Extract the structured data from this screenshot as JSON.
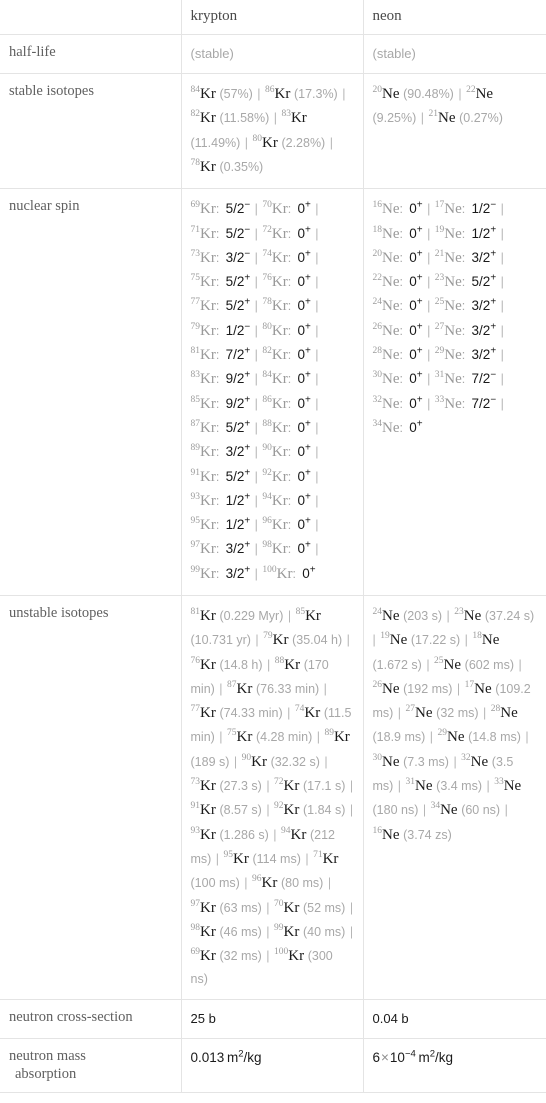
{
  "table": {
    "columns": [
      "",
      "krypton",
      "neon"
    ],
    "rows": [
      {
        "label": "half-life",
        "krypton": {
          "kind": "plain_muted",
          "text": "(stable)"
        },
        "neon": {
          "kind": "plain_muted",
          "text": "(stable)"
        }
      },
      {
        "label": "stable isotopes",
        "krypton": {
          "kind": "isotope_list",
          "items": [
            {
              "mass": "84",
              "symbol": "Kr",
              "value": "(57%)"
            },
            {
              "mass": "86",
              "symbol": "Kr",
              "value": "(17.3%)"
            },
            {
              "mass": "82",
              "symbol": "Kr",
              "value": "(11.58%)"
            },
            {
              "mass": "83",
              "symbol": "Kr",
              "value": "(11.49%)"
            },
            {
              "mass": "80",
              "symbol": "Kr",
              "value": "(2.28%)"
            },
            {
              "mass": "78",
              "symbol": "Kr",
              "value": "(0.35%)"
            }
          ]
        },
        "neon": {
          "kind": "isotope_list",
          "items": [
            {
              "mass": "20",
              "symbol": "Ne",
              "value": "(90.48%)"
            },
            {
              "mass": "22",
              "symbol": "Ne",
              "value": "(9.25%)"
            },
            {
              "mass": "21",
              "symbol": "Ne",
              "value": "(0.27%)"
            }
          ]
        }
      },
      {
        "label": "nuclear spin",
        "krypton": {
          "kind": "spin_list",
          "items": [
            {
              "mass": "69",
              "symbol": "Kr",
              "spin": "5/2",
              "sign": "−"
            },
            {
              "mass": "70",
              "symbol": "Kr",
              "spin": "0",
              "sign": "+"
            },
            {
              "mass": "71",
              "symbol": "Kr",
              "spin": "5/2",
              "sign": "−"
            },
            {
              "mass": "72",
              "symbol": "Kr",
              "spin": "0",
              "sign": "+"
            },
            {
              "mass": "73",
              "symbol": "Kr",
              "spin": "3/2",
              "sign": "−"
            },
            {
              "mass": "74",
              "symbol": "Kr",
              "spin": "0",
              "sign": "+"
            },
            {
              "mass": "75",
              "symbol": "Kr",
              "spin": "5/2",
              "sign": "+"
            },
            {
              "mass": "76",
              "symbol": "Kr",
              "spin": "0",
              "sign": "+"
            },
            {
              "mass": "77",
              "symbol": "Kr",
              "spin": "5/2",
              "sign": "+"
            },
            {
              "mass": "78",
              "symbol": "Kr",
              "spin": "0",
              "sign": "+"
            },
            {
              "mass": "79",
              "symbol": "Kr",
              "spin": "1/2",
              "sign": "−"
            },
            {
              "mass": "80",
              "symbol": "Kr",
              "spin": "0",
              "sign": "+"
            },
            {
              "mass": "81",
              "symbol": "Kr",
              "spin": "7/2",
              "sign": "+"
            },
            {
              "mass": "82",
              "symbol": "Kr",
              "spin": "0",
              "sign": "+"
            },
            {
              "mass": "83",
              "symbol": "Kr",
              "spin": "9/2",
              "sign": "+"
            },
            {
              "mass": "84",
              "symbol": "Kr",
              "spin": "0",
              "sign": "+"
            },
            {
              "mass": "85",
              "symbol": "Kr",
              "spin": "9/2",
              "sign": "+"
            },
            {
              "mass": "86",
              "symbol": "Kr",
              "spin": "0",
              "sign": "+"
            },
            {
              "mass": "87",
              "symbol": "Kr",
              "spin": "5/2",
              "sign": "+"
            },
            {
              "mass": "88",
              "symbol": "Kr",
              "spin": "0",
              "sign": "+"
            },
            {
              "mass": "89",
              "symbol": "Kr",
              "spin": "3/2",
              "sign": "+"
            },
            {
              "mass": "90",
              "symbol": "Kr",
              "spin": "0",
              "sign": "+"
            },
            {
              "mass": "91",
              "symbol": "Kr",
              "spin": "5/2",
              "sign": "+"
            },
            {
              "mass": "92",
              "symbol": "Kr",
              "spin": "0",
              "sign": "+"
            },
            {
              "mass": "93",
              "symbol": "Kr",
              "spin": "1/2",
              "sign": "+"
            },
            {
              "mass": "94",
              "symbol": "Kr",
              "spin": "0",
              "sign": "+"
            },
            {
              "mass": "95",
              "symbol": "Kr",
              "spin": "1/2",
              "sign": "+"
            },
            {
              "mass": "96",
              "symbol": "Kr",
              "spin": "0",
              "sign": "+"
            },
            {
              "mass": "97",
              "symbol": "Kr",
              "spin": "3/2",
              "sign": "+"
            },
            {
              "mass": "98",
              "symbol": "Kr",
              "spin": "0",
              "sign": "+"
            },
            {
              "mass": "99",
              "symbol": "Kr",
              "spin": "3/2",
              "sign": "+"
            },
            {
              "mass": "100",
              "symbol": "Kr",
              "spin": "0",
              "sign": "+"
            }
          ]
        },
        "neon": {
          "kind": "spin_list",
          "items": [
            {
              "mass": "16",
              "symbol": "Ne",
              "spin": "0",
              "sign": "+"
            },
            {
              "mass": "17",
              "symbol": "Ne",
              "spin": "1/2",
              "sign": "−"
            },
            {
              "mass": "18",
              "symbol": "Ne",
              "spin": "0",
              "sign": "+"
            },
            {
              "mass": "19",
              "symbol": "Ne",
              "spin": "1/2",
              "sign": "+"
            },
            {
              "mass": "20",
              "symbol": "Ne",
              "spin": "0",
              "sign": "+"
            },
            {
              "mass": "21",
              "symbol": "Ne",
              "spin": "3/2",
              "sign": "+"
            },
            {
              "mass": "22",
              "symbol": "Ne",
              "spin": "0",
              "sign": "+"
            },
            {
              "mass": "23",
              "symbol": "Ne",
              "spin": "5/2",
              "sign": "+"
            },
            {
              "mass": "24",
              "symbol": "Ne",
              "spin": "0",
              "sign": "+"
            },
            {
              "mass": "25",
              "symbol": "Ne",
              "spin": "3/2",
              "sign": "+"
            },
            {
              "mass": "26",
              "symbol": "Ne",
              "spin": "0",
              "sign": "+"
            },
            {
              "mass": "27",
              "symbol": "Ne",
              "spin": "3/2",
              "sign": "+"
            },
            {
              "mass": "28",
              "symbol": "Ne",
              "spin": "0",
              "sign": "+"
            },
            {
              "mass": "29",
              "symbol": "Ne",
              "spin": "3/2",
              "sign": "+"
            },
            {
              "mass": "30",
              "symbol": "Ne",
              "spin": "0",
              "sign": "+"
            },
            {
              "mass": "31",
              "symbol": "Ne",
              "spin": "7/2",
              "sign": "−"
            },
            {
              "mass": "32",
              "symbol": "Ne",
              "spin": "0",
              "sign": "+"
            },
            {
              "mass": "33",
              "symbol": "Ne",
              "spin": "7/2",
              "sign": "−"
            },
            {
              "mass": "34",
              "symbol": "Ne",
              "spin": "0",
              "sign": "+"
            }
          ]
        }
      },
      {
        "label": "unstable isotopes",
        "krypton": {
          "kind": "isotope_list",
          "items": [
            {
              "mass": "81",
              "symbol": "Kr",
              "value": "(0.229 Myr)"
            },
            {
              "mass": "85",
              "symbol": "Kr",
              "value": "(10.731 yr)"
            },
            {
              "mass": "79",
              "symbol": "Kr",
              "value": "(35.04 h)"
            },
            {
              "mass": "76",
              "symbol": "Kr",
              "value": "(14.8 h)"
            },
            {
              "mass": "88",
              "symbol": "Kr",
              "value": "(170 min)"
            },
            {
              "mass": "87",
              "symbol": "Kr",
              "value": "(76.33 min)"
            },
            {
              "mass": "77",
              "symbol": "Kr",
              "value": "(74.33 min)"
            },
            {
              "mass": "74",
              "symbol": "Kr",
              "value": "(11.5 min)"
            },
            {
              "mass": "75",
              "symbol": "Kr",
              "value": "(4.28 min)"
            },
            {
              "mass": "89",
              "symbol": "Kr",
              "value": "(189 s)"
            },
            {
              "mass": "90",
              "symbol": "Kr",
              "value": "(32.32 s)"
            },
            {
              "mass": "73",
              "symbol": "Kr",
              "value": "(27.3 s)"
            },
            {
              "mass": "72",
              "symbol": "Kr",
              "value": "(17.1 s)"
            },
            {
              "mass": "91",
              "symbol": "Kr",
              "value": "(8.57 s)"
            },
            {
              "mass": "92",
              "symbol": "Kr",
              "value": "(1.84 s)"
            },
            {
              "mass": "93",
              "symbol": "Kr",
              "value": "(1.286 s)"
            },
            {
              "mass": "94",
              "symbol": "Kr",
              "value": "(212 ms)"
            },
            {
              "mass": "95",
              "symbol": "Kr",
              "value": "(114 ms)"
            },
            {
              "mass": "71",
              "symbol": "Kr",
              "value": "(100 ms)"
            },
            {
              "mass": "96",
              "symbol": "Kr",
              "value": "(80 ms)"
            },
            {
              "mass": "97",
              "symbol": "Kr",
              "value": "(63 ms)"
            },
            {
              "mass": "70",
              "symbol": "Kr",
              "value": "(52 ms)"
            },
            {
              "mass": "98",
              "symbol": "Kr",
              "value": "(46 ms)"
            },
            {
              "mass": "99",
              "symbol": "Kr",
              "value": "(40 ms)"
            },
            {
              "mass": "69",
              "symbol": "Kr",
              "value": "(32 ms)"
            },
            {
              "mass": "100",
              "symbol": "Kr",
              "value": "(300 ns)"
            }
          ]
        },
        "neon": {
          "kind": "isotope_list",
          "items": [
            {
              "mass": "24",
              "symbol": "Ne",
              "value": "(203 s)"
            },
            {
              "mass": "23",
              "symbol": "Ne",
              "value": "(37.24 s)"
            },
            {
              "mass": "19",
              "symbol": "Ne",
              "value": "(17.22 s)"
            },
            {
              "mass": "18",
              "symbol": "Ne",
              "value": "(1.672 s)"
            },
            {
              "mass": "25",
              "symbol": "Ne",
              "value": "(602 ms)"
            },
            {
              "mass": "26",
              "symbol": "Ne",
              "value": "(192 ms)"
            },
            {
              "mass": "17",
              "symbol": "Ne",
              "value": "(109.2 ms)"
            },
            {
              "mass": "27",
              "symbol": "Ne",
              "value": "(32 ms)"
            },
            {
              "mass": "28",
              "symbol": "Ne",
              "value": "(18.9 ms)"
            },
            {
              "mass": "29",
              "symbol": "Ne",
              "value": "(14.8 ms)"
            },
            {
              "mass": "30",
              "symbol": "Ne",
              "value": "(7.3 ms)"
            },
            {
              "mass": "32",
              "symbol": "Ne",
              "value": "(3.5 ms)"
            },
            {
              "mass": "31",
              "symbol": "Ne",
              "value": "(3.4 ms)"
            },
            {
              "mass": "33",
              "symbol": "Ne",
              "value": "(180 ns)"
            },
            {
              "mass": "34",
              "symbol": "Ne",
              "value": "(60 ns)"
            },
            {
              "mass": "16",
              "symbol": "Ne",
              "value": "(3.74 zs)"
            }
          ]
        }
      },
      {
        "label": "neutron cross-section",
        "krypton": {
          "kind": "plain",
          "text": "25 b"
        },
        "neon": {
          "kind": "plain",
          "text": "0.04 b"
        }
      },
      {
        "label": "neutron mass absorption",
        "label_line1": "neutron mass",
        "label_line2": "absorption",
        "krypton": {
          "kind": "unit",
          "mantissa": "0.013",
          "unit_base": "m",
          "unit_exp": "2",
          "unit_tail": "/kg"
        },
        "neon": {
          "kind": "unit",
          "mantissa": "6",
          "times": "×",
          "power_base": "10",
          "power_exp": "−4",
          "unit_base": "m",
          "unit_exp": "2",
          "unit_tail": "/kg"
        }
      }
    ]
  },
  "colors": {
    "border": "#e4e4e4",
    "text_dark": "#1a1a1a",
    "text_muted": "#a8a8a8",
    "label": "#606060",
    "header": "#4a4a4a"
  },
  "separator": "|"
}
